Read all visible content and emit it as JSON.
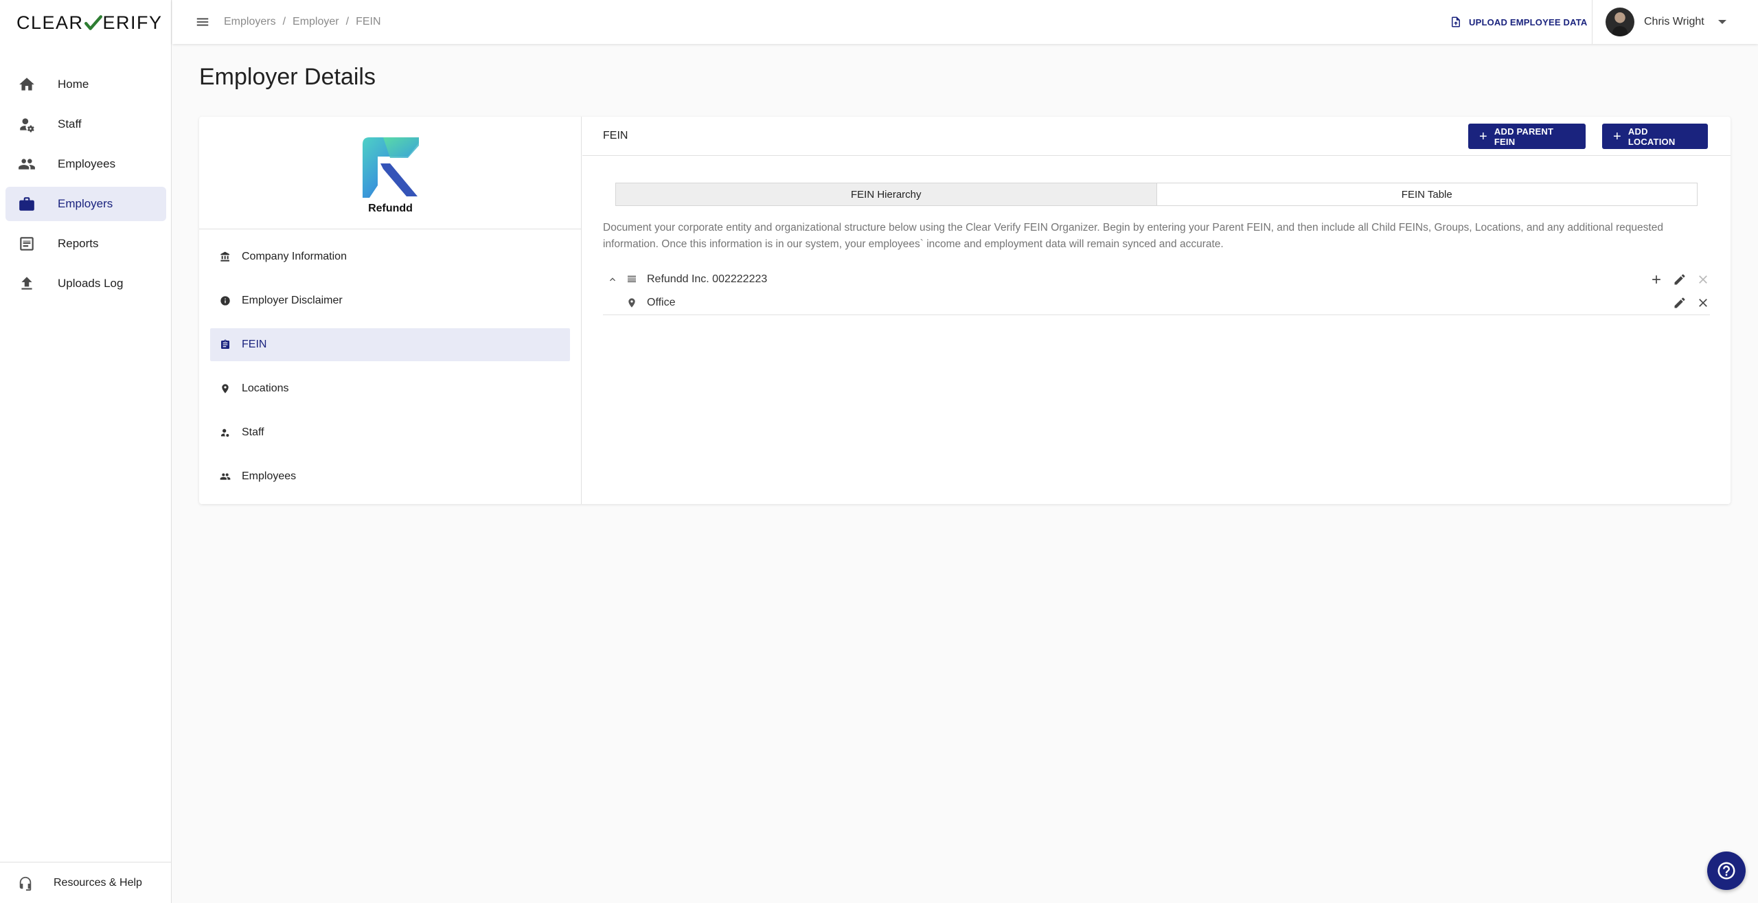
{
  "brand": {
    "left": "CLEAR",
    "right": "ERIFY"
  },
  "sidebar": {
    "items": [
      {
        "label": "Home",
        "icon": "home-icon"
      },
      {
        "label": "Staff",
        "icon": "staff-icon"
      },
      {
        "label": "Employees",
        "icon": "employees-icon"
      },
      {
        "label": "Employers",
        "icon": "briefcase-icon"
      },
      {
        "label": "Reports",
        "icon": "reports-icon"
      },
      {
        "label": "Uploads Log",
        "icon": "upload-icon"
      }
    ],
    "active": "Employers",
    "bottom_label": "Resources & Help"
  },
  "topbar": {
    "breadcrumb": [
      "Employers",
      "Employer",
      "FEIN"
    ],
    "upload_label": "UPLOAD EMPLOYEE DATA",
    "user_name": "Chris Wright"
  },
  "page": {
    "title": "Employer Details"
  },
  "company": {
    "name": "Refundd",
    "menu": [
      {
        "label": "Company Information"
      },
      {
        "label": "Employer Disclaimer"
      },
      {
        "label": "FEIN"
      },
      {
        "label": "Locations"
      },
      {
        "label": "Staff"
      },
      {
        "label": "Employees"
      }
    ],
    "active": "FEIN"
  },
  "fein": {
    "header": "FEIN",
    "add_parent_label": "ADD PARENT FEIN",
    "add_location_label": "ADD LOCATION",
    "tabs": [
      "FEIN Hierarchy",
      "FEIN Table"
    ],
    "active_tab": "FEIN Hierarchy",
    "description": "Document your corporate entity and organizational structure below using the Clear Verify FEIN Organizer. Begin by entering your Parent FEIN, and then include all Child FEINs, Groups, Locations, and any additional requested information. Once this information is in our system, your employees` income and employment data will remain synced and accurate.",
    "tree": [
      {
        "label": "Refundd Inc. 002222223",
        "type": "fein"
      },
      {
        "label": "Office",
        "type": "location"
      }
    ]
  },
  "colors": {
    "primary": "#1a237e",
    "active_bg": "#e8eaf6"
  }
}
